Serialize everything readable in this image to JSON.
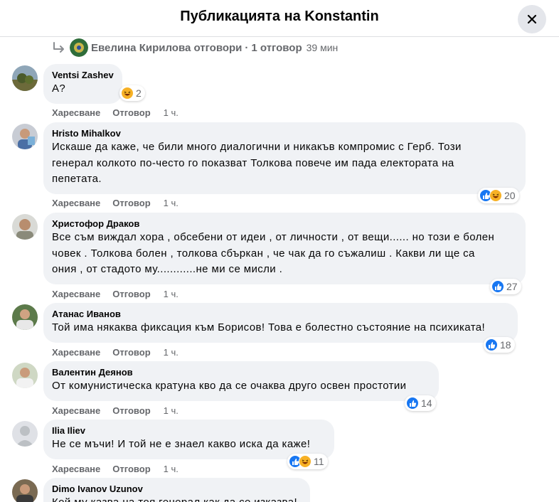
{
  "header": {
    "title": "Публикацията на Konstantin",
    "close_icon": "close-icon"
  },
  "reply_thread": {
    "name": "Евелина Кирилова отговори",
    "separator": "·",
    "count": "1 отговор",
    "time": "39 мин"
  },
  "actions": {
    "like": "Харесване",
    "reply": "Отговор"
  },
  "comments": [
    {
      "author": "Ventsi Zashev",
      "lines": [
        "А?"
      ],
      "reactions": [
        "haha"
      ],
      "count": "2",
      "time": "1 ч."
    },
    {
      "author": "Hristo Mihalkov",
      "lines": [
        "Искаше да каже, че били много диалогични и никакъв компромис с Герб. Този",
        "генерал колкото по-често го показват Толкова повече им пада електората на",
        "пепетата."
      ],
      "reactions": [
        "like",
        "haha"
      ],
      "count": "20",
      "time": "1 ч."
    },
    {
      "author": "Христофор Драков",
      "lines": [
        "Все съм виждал хора , обсебени от идеи , от личности , от вещи...... но този е болен",
        "човек . Толкова болен , толкова сбъркан , че чак да го съжалиш . Какви ли ще са",
        "ония , от стадото му............не ми се мисли ."
      ],
      "reactions": [
        "like"
      ],
      "count": "27",
      "time": "1 ч."
    },
    {
      "author": "Атанас Иванов",
      "lines": [
        "Той има някаква фиксация към Борисов! Това е болестно състояние на психиката!"
      ],
      "reactions": [
        "like"
      ],
      "count": "18",
      "time": "1 ч."
    },
    {
      "author": "Валентин Деянов",
      "lines": [
        "От комунистическа кратуна кво да се очаква друго освен простотии"
      ],
      "reactions": [
        "like"
      ],
      "count": "14",
      "time": "1 ч."
    },
    {
      "author": "Ilia Iliev",
      "lines": [
        "Не се мъчи! И той не е знаел какво иска да каже!"
      ],
      "reactions": [
        "like",
        "haha"
      ],
      "count": "11",
      "time": "1 ч."
    },
    {
      "author": "Dimo Ivanov Uzunov",
      "lines": [
        "Кой му казва на тоя генерал как да се изказва! Не разбира"
      ]
    }
  ],
  "colors": {
    "like": "#1877f2",
    "haha": "#f7b125",
    "bubble": "#f0f2f5",
    "muted": "#65676b"
  }
}
